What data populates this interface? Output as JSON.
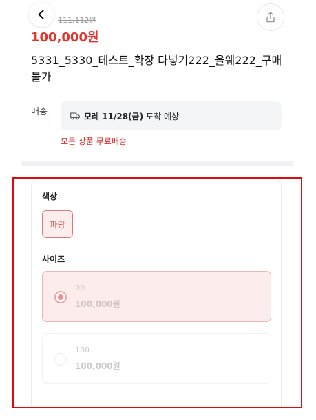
{
  "header": {
    "back_icon": "chevron-left-icon",
    "share_icon": "share-icon"
  },
  "product": {
    "original_price": "111,112원",
    "sale_price": "100,000원",
    "name": "5331_5330_테스트_확장 다넣기222_올웨222_구매불가"
  },
  "shipping": {
    "label": "배송",
    "truck_icon": "truck-icon",
    "arrival_date": "모레 11/28(금)",
    "arrival_suffix": "도착 예상",
    "free_notice": "모든 상품 무료배송"
  },
  "options": {
    "color_title": "색상",
    "colors": [
      {
        "label": "파랑",
        "selected": true
      }
    ],
    "size_title": "사이즈",
    "sizes": [
      {
        "name": "90",
        "price": "100,000원",
        "selected": true
      },
      {
        "name": "100",
        "price": "100,000원",
        "selected": false
      }
    ]
  },
  "colors": {
    "accent": "#e2332c",
    "highlight_frame": "#e00a0a",
    "selected_bg": "#fdecec"
  }
}
